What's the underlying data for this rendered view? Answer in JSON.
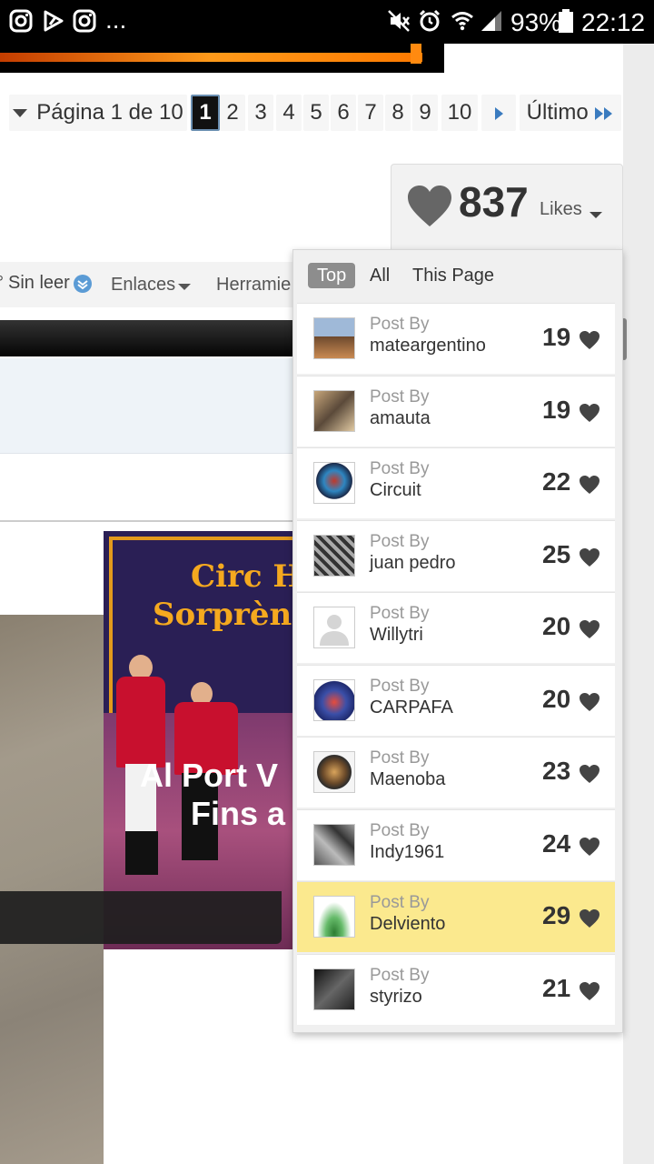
{
  "status_bar": {
    "battery": "93%",
    "time": "22:12",
    "overflow": "...",
    "icons": [
      "instagram-icon",
      "play-store-icon",
      "instagram-icon",
      "mute-icon",
      "alarm-icon",
      "wifi-icon",
      "signal-icon",
      "battery-icon"
    ]
  },
  "pagination": {
    "label": "Página 1 de 10",
    "pages": [
      "1",
      "2",
      "3",
      "4",
      "5",
      "6",
      "7",
      "8",
      "9",
      "10"
    ],
    "current": "1",
    "last_label": "Último"
  },
  "likes": {
    "count": "837",
    "label": "Likes"
  },
  "forum_nav": {
    "unread": "Sin leer",
    "links": "Enlaces",
    "tools": "Herramie"
  },
  "likes_panel": {
    "tabs": [
      "Top",
      "All",
      "This Page"
    ],
    "active_tab": "Top",
    "post_by_label": "Post By",
    "entries": [
      {
        "user": "mateargentino",
        "count": "19"
      },
      {
        "user": "amauta",
        "count": "19"
      },
      {
        "user": "Circuit",
        "count": "22"
      },
      {
        "user": "juan pedro",
        "count": "25"
      },
      {
        "user": "Willytri",
        "count": "20"
      },
      {
        "user": "CARPAFA",
        "count": "20"
      },
      {
        "user": "Maenoba",
        "count": "23"
      },
      {
        "user": "Indy1961",
        "count": "24"
      },
      {
        "user": "Delviento",
        "count": "29",
        "highlighted": true
      },
      {
        "user": "styrizo",
        "count": "21"
      }
    ]
  },
  "ad": {
    "line1": "Circ H",
    "line2": "Sorprèn",
    "line3": "Al Port V",
    "line4": "Fins a"
  },
  "colors": {
    "highlight": "#fbe98e",
    "ad_gold": "#f5a91f",
    "ad_purple": "#2a1f55",
    "pagination_active": "#111111"
  }
}
